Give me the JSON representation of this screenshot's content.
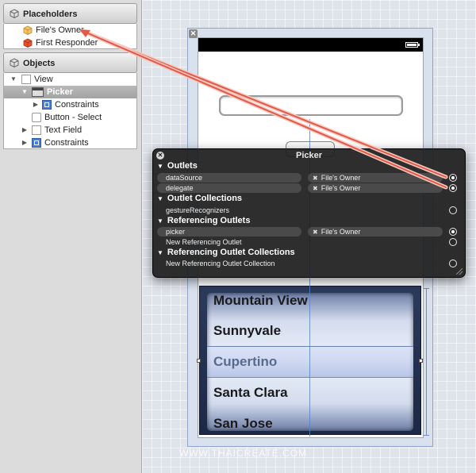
{
  "placeholders": {
    "header": "Placeholders",
    "items": [
      {
        "label": "File's Owner",
        "icon": "files-owner-cube-icon"
      },
      {
        "label": "First Responder",
        "icon": "first-responder-cube-icon"
      }
    ]
  },
  "objects": {
    "header": "Objects",
    "items": [
      {
        "label": "View",
        "icon": "view-icon",
        "expanded": true
      },
      {
        "label": "Picker",
        "icon": "picker-icon",
        "expanded": true,
        "selected": true
      },
      {
        "label": "Constraints",
        "icon": "constraints-icon",
        "expanded": false
      },
      {
        "label": "Button - Select",
        "icon": "button-icon"
      },
      {
        "label": "Text Field",
        "icon": "text-field-icon",
        "expanded": false
      },
      {
        "label": "Constraints",
        "icon": "constraints-icon",
        "expanded": false
      }
    ]
  },
  "picker_wheel": {
    "items": [
      "Mountain View",
      "Sunnyvale",
      "Cupertino",
      "Santa Clara",
      "San Jose"
    ],
    "selected": "Cupertino"
  },
  "hud": {
    "title": "Picker",
    "sections": {
      "outlets": "Outlets",
      "outlet_collections": "Outlet Collections",
      "referencing_outlets": "Referencing Outlets",
      "referencing_outlet_collections": "Referencing Outlet Collections"
    },
    "rows": {
      "datasource": {
        "name": "dataSource",
        "target": "File's Owner",
        "connected": true
      },
      "delegate": {
        "name": "delegate",
        "target": "File's Owner",
        "connected": true
      },
      "gesture": {
        "name": "gestureRecognizers",
        "connected": false
      },
      "picker": {
        "name": "picker",
        "target": "File's Owner",
        "connected": true
      },
      "new_ref": {
        "name": "New Referencing Outlet",
        "connected": false
      },
      "new_ref_coll": {
        "name": "New Referencing Outlet Collection",
        "connected": false
      }
    }
  },
  "colors": {
    "connection_arrow": "#e05a4a",
    "selection": "#a8a8a8"
  },
  "watermark": "WWW.THAICREATE.COM"
}
